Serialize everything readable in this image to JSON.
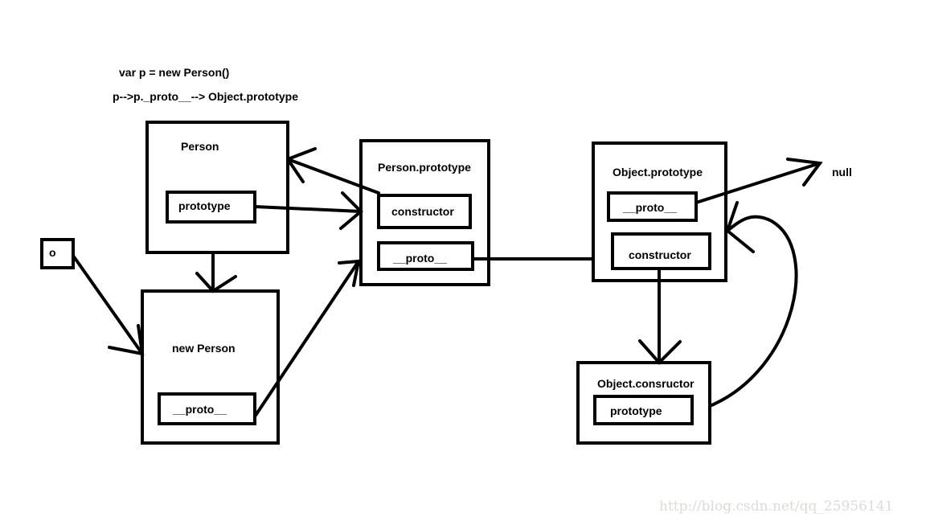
{
  "notes": {
    "line1": "var p = new Person()",
    "line2": "p-->p._proto__--> Object.prototype"
  },
  "nodes": {
    "person": {
      "title": "Person",
      "field": "prototype"
    },
    "person_prototype": {
      "title": "Person.prototype",
      "field1": "constructor",
      "field2": "__proto__"
    },
    "object_prototype": {
      "title": "Object.prototype",
      "field1": "__proto__",
      "field2": "constructor"
    },
    "null": "null",
    "o": "o",
    "new_person": {
      "title": "new  Person",
      "field": "__proto__"
    },
    "object_constructor": {
      "title": "Object.consructor",
      "field": "prototype"
    }
  },
  "watermark": "http://blog.csdn.net/qq_25956141"
}
